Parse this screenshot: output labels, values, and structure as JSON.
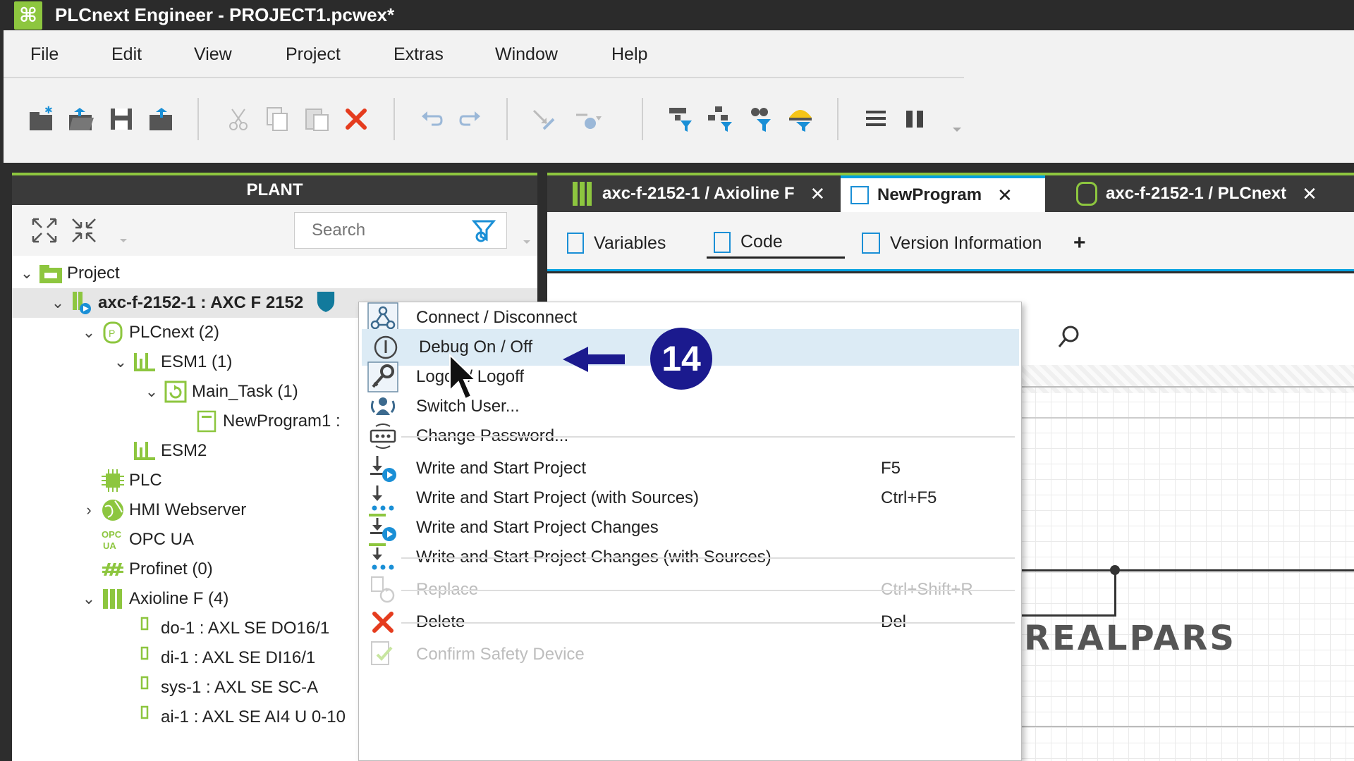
{
  "window": {
    "title": "PLCnext Engineer - PROJECT1.pcwex*"
  },
  "menu": [
    "File",
    "Edit",
    "View",
    "Project",
    "Extras",
    "Window",
    "Help"
  ],
  "plant": {
    "header": "PLANT",
    "search_placeholder": "Search",
    "tree": [
      {
        "label": "Project",
        "caret": "⌄",
        "icon": "project-folder-icon"
      },
      {
        "label": "axc-f-2152-1 : AXC F 2152",
        "caret": "⌄",
        "icon": "controller-icon",
        "bold": true
      },
      {
        "label": "PLCnext (2)",
        "caret": "⌄",
        "icon": "plcnext-icon"
      },
      {
        "label": "ESM1 (1)",
        "caret": "⌄",
        "icon": "esm-icon"
      },
      {
        "label": "Main_Task (1)",
        "caret": "⌄",
        "icon": "task-icon"
      },
      {
        "label": "NewProgram1 :",
        "caret": "",
        "icon": "program-icon"
      },
      {
        "label": "ESM2",
        "caret": "",
        "icon": "esm-icon"
      },
      {
        "label": "PLC",
        "caret": "",
        "icon": "plc-chip-icon"
      },
      {
        "label": "HMI Webserver",
        "caret": "›",
        "icon": "globe-icon"
      },
      {
        "label": "OPC UA",
        "caret": "",
        "icon": "opcua-icon"
      },
      {
        "label": "Profinet (0)",
        "caret": "",
        "icon": "profinet-icon"
      },
      {
        "label": "Axioline F (4)",
        "caret": "⌄",
        "icon": "axioline-icon"
      },
      {
        "label": "do-1 : AXL SE DO16/1",
        "caret": "",
        "icon": "module-icon"
      },
      {
        "label": "di-1 : AXL SE DI16/1",
        "caret": "",
        "icon": "module-icon"
      },
      {
        "label": "sys-1 : AXL SE SC-A",
        "caret": "",
        "icon": "module-icon"
      },
      {
        "label": "ai-1 : AXL SE AI4 U 0-10",
        "caret": "",
        "icon": "module-icon"
      }
    ]
  },
  "editor": {
    "tabs": [
      {
        "label": "axc-f-2152-1 / Axioline F",
        "close": "✕"
      },
      {
        "label": "NewProgram",
        "close": "✕"
      },
      {
        "label": "axc-f-2152-1 / PLCnext",
        "close": "✕"
      }
    ],
    "subtabs": [
      "Variables",
      "Code",
      "Version Information"
    ],
    "add_tab": "+",
    "watermark": "REALPARS"
  },
  "context_menu": {
    "items": [
      {
        "label": "Connect / Disconnect",
        "shortcut": "",
        "icon": "network-icon"
      },
      {
        "label": "Debug On / Off",
        "shortcut": "",
        "icon": "debug-icon"
      },
      {
        "label": "Logon / Logoff",
        "shortcut": "",
        "icon": "key-icon"
      },
      {
        "label": "Switch User...",
        "shortcut": "",
        "icon": "switch-user-icon"
      },
      {
        "label": "Change Password...",
        "shortcut": "",
        "icon": "password-icon"
      },
      {
        "label": "Write and Start Project",
        "shortcut": "F5",
        "icon": "download-start-icon"
      },
      {
        "label": "Write and Start Project (with Sources)",
        "shortcut": "Ctrl+F5",
        "icon": "download-sources-icon"
      },
      {
        "label": "Write and Start Project Changes",
        "shortcut": "",
        "icon": "download-changes-icon"
      },
      {
        "label": "Write and Start Project Changes (with Sources)",
        "shortcut": "",
        "icon": "download-changes-sources-icon"
      },
      {
        "label": "Replace",
        "shortcut": "Ctrl+Shift+R",
        "icon": "replace-icon",
        "disabled": true
      },
      {
        "label": "Delete",
        "shortcut": "Del",
        "icon": "delete-icon"
      },
      {
        "label": "Confirm Safety Device",
        "shortcut": "",
        "icon": "safety-confirm-icon",
        "disabled": true
      }
    ]
  },
  "annotation": {
    "step": "14"
  }
}
